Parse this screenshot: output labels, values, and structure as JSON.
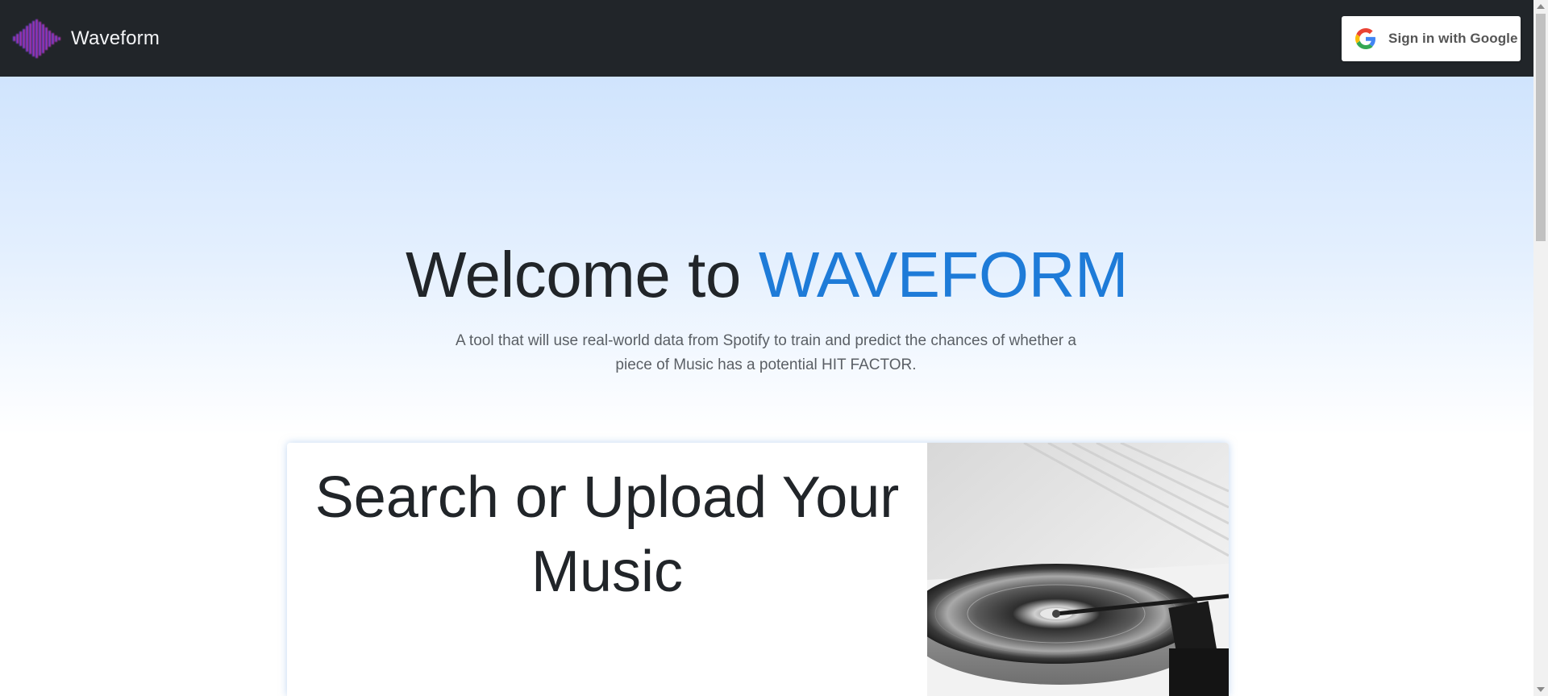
{
  "navbar": {
    "brand_name": "Waveform",
    "signin_label": "Sign in with Google",
    "logo_icon": "waveform-logo-icon",
    "google_icon": "google-g-icon",
    "background": "#212529"
  },
  "hero": {
    "welcome_prefix": "Welcome to",
    "welcome_brand": "WAVEFORM",
    "subtitle": "A tool that will use real-world data from Spotify to train and predict the chances of whether a piece of Music has a potential HIT FACTOR.",
    "accent_color": "#1e7bd8"
  },
  "card": {
    "title": "Search or Upload Your Music",
    "image_icon": "turntable-photo"
  }
}
